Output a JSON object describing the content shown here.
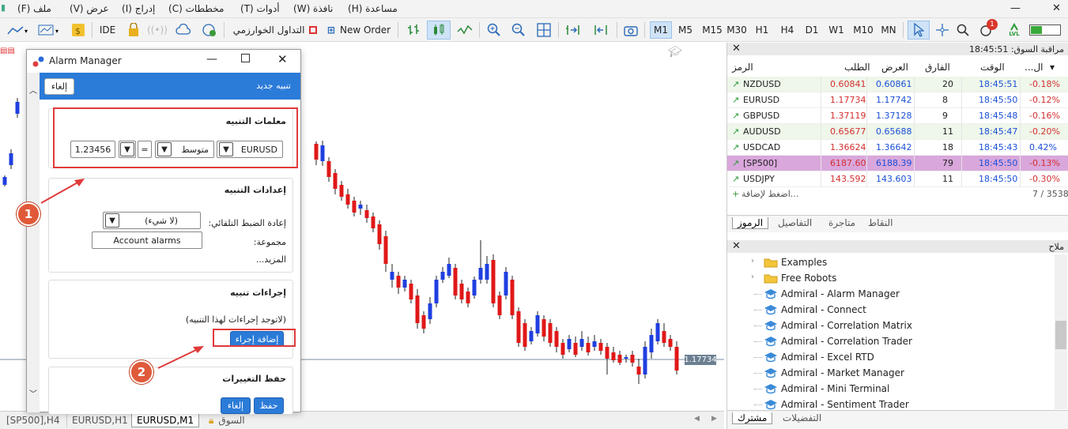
{
  "menu": [
    "ملف (F)",
    "عرض (V)",
    "إدراج (I)",
    "مخططات (C)",
    "أدوات (T)",
    "نافذة (W)",
    "مساعدة (H)"
  ],
  "toolbar": {
    "ide": "IDE",
    "algo_trading": "التداول الخوارزمي",
    "new_order": "New Order",
    "timeframes": [
      "M1",
      "M5",
      "M15",
      "M30",
      "H1",
      "H4",
      "D1",
      "W1",
      "M10",
      "MN"
    ],
    "active_timeframe": "M1",
    "lvl": "LVL",
    "notification_count": "1"
  },
  "chart": {
    "price_label": "1.17734"
  },
  "bottom_tabs": [
    "[SP500],H4",
    "EURUSD,H1",
    "EURUSD,M1",
    "السوق"
  ],
  "dialog": {
    "title": "Alarm Manager",
    "header_label": "تنبيه جديد",
    "cancel_top": "إلغاء",
    "params": {
      "title": "معلمات التنبيه",
      "symbol": "EURUSD",
      "indicator": "متوسط",
      "operator": "=",
      "value": "1.23456"
    },
    "settings": {
      "title": "إعدادات التنبيه",
      "reset_label": "إعادة الضبط التلقائي:",
      "reset_value": "(لا شيء)",
      "group_label": "مجموعة:",
      "group_value": "Account alarms",
      "more": "المزيد..."
    },
    "actions": {
      "title": "إجراءات تنبيه",
      "empty": "(لاتوجد إجراءات لهذا التنبيه)",
      "add": "إضافة إجراء"
    },
    "save": {
      "title": "حفظ التغييرات",
      "cancel": "إلغاء",
      "save": "حفظ"
    }
  },
  "callouts": [
    "1",
    "2"
  ],
  "market_watch": {
    "title": "مراقبة السوق: 18:45:51",
    "columns": {
      "symbol": "الرمز",
      "bid": "الطلب",
      "ask": "العرض",
      "spread": "الفارق",
      "time": "الوقت",
      "change": "...ال"
    },
    "rows": [
      {
        "symbol": "NZDUSD",
        "bid": "0.60841",
        "ask": "0.60861",
        "spread": "20",
        "time": "18:45:51",
        "change": "-0.18%"
      },
      {
        "symbol": "EURUSD",
        "bid": "1.17734",
        "ask": "1.17742",
        "spread": "8",
        "time": "18:45:50",
        "change": "-0.12%"
      },
      {
        "symbol": "GBPUSD",
        "bid": "1.37119",
        "ask": "1.37128",
        "spread": "9",
        "time": "18:45:48",
        "change": "-0.16%"
      },
      {
        "symbol": "AUDUSD",
        "bid": "0.65677",
        "ask": "0.65688",
        "spread": "11",
        "time": "18:45:47",
        "change": "-0.20%"
      },
      {
        "symbol": "USDCAD",
        "bid": "1.36624",
        "ask": "1.36642",
        "spread": "18",
        "time": "18:45:43",
        "change": "0.42%"
      },
      {
        "symbol": "[SP500]",
        "bid": "6187.60",
        "ask": "6188.39",
        "spread": "79",
        "time": "18:45:50",
        "change": "-0.13%"
      },
      {
        "symbol": "USDJPY",
        "bid": "143.592",
        "ask": "143.603",
        "spread": "11",
        "time": "18:45:50",
        "change": "-0.30%"
      }
    ],
    "add_label": "اضغط لإضافة...",
    "count": "7 / 3538",
    "tabs": [
      "الرموز",
      "التفاصيل",
      "متاجرة",
      "النقاط"
    ]
  },
  "navigator": {
    "title": "ملاح",
    "items": [
      "Examples",
      "Free Robots",
      "Admiral - Alarm Manager",
      "Admiral - Connect",
      "Admiral - Correlation Matrix",
      "Admiral - Correlation Trader",
      "Admiral - Excel RTD",
      "Admiral - Market Manager",
      "Admiral - Mini Terminal",
      "Admiral - Sentiment Trader"
    ],
    "tabs": [
      "مشترك",
      "التفضيلات"
    ]
  }
}
